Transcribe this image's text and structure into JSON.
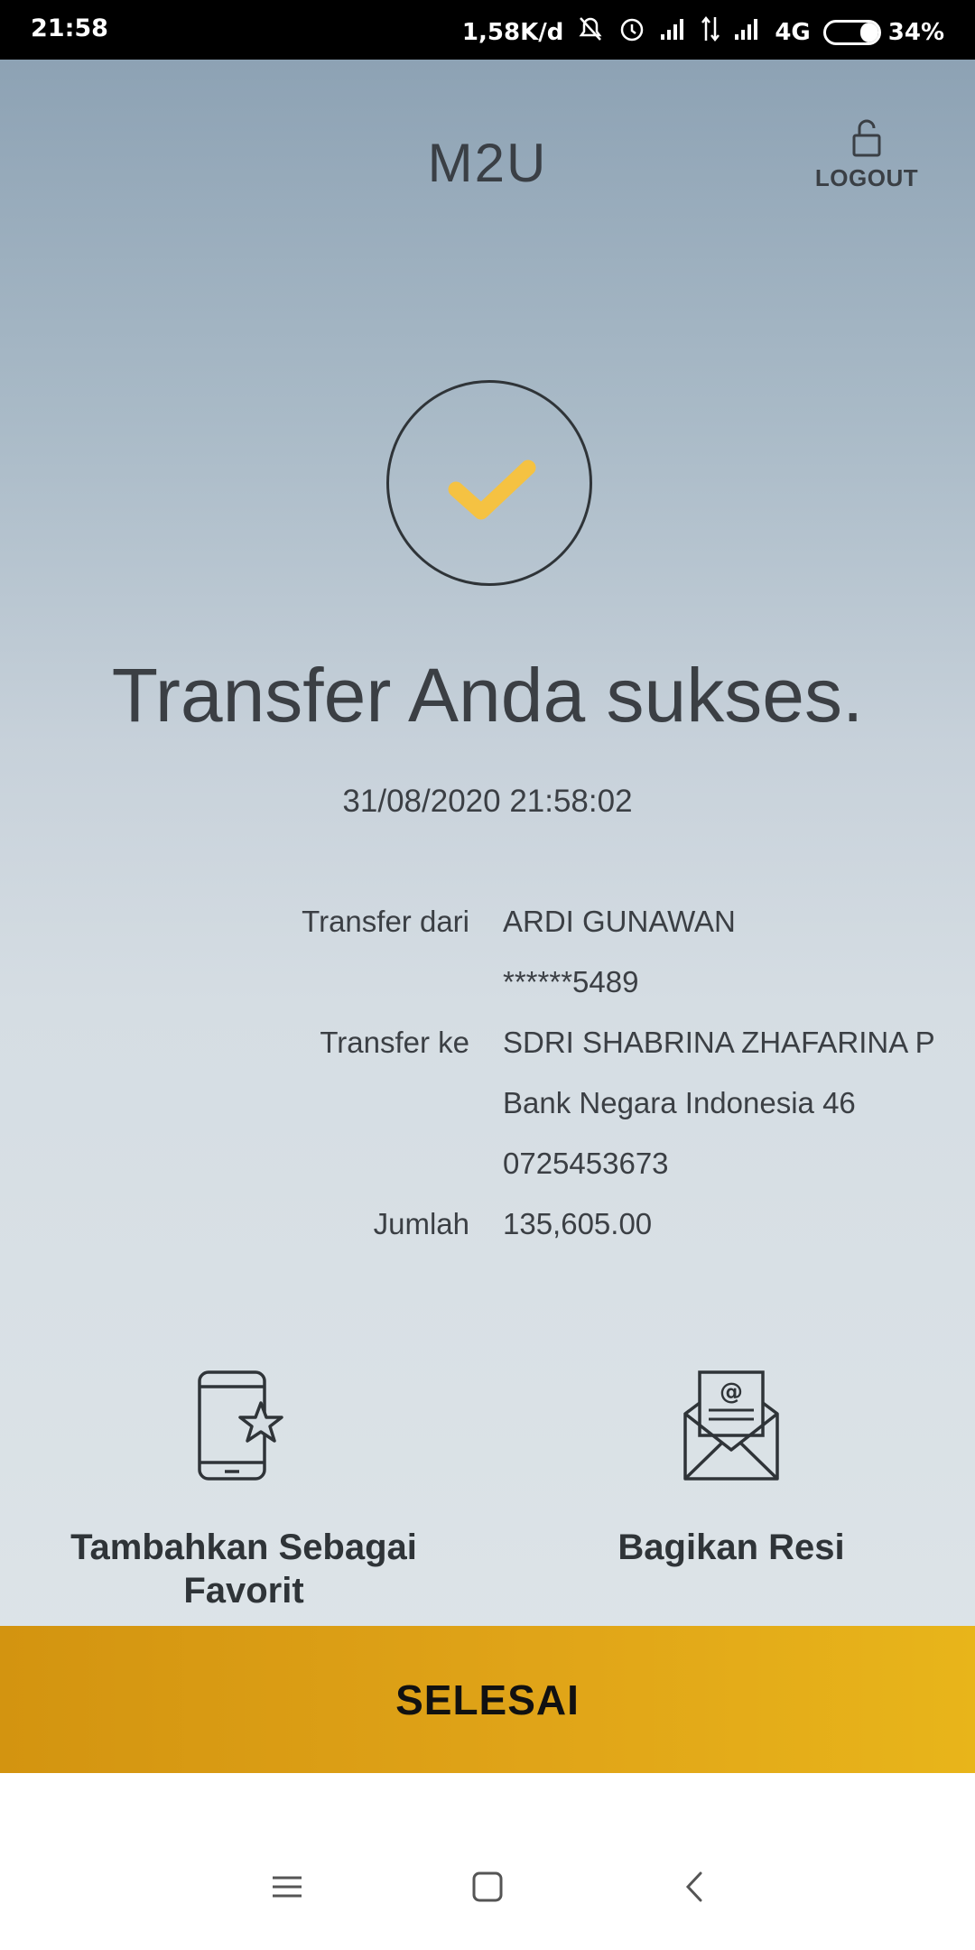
{
  "status_bar": {
    "time": "21:58",
    "speed": "1,58K/d",
    "network": "4G",
    "battery": "34%",
    "battery_level": 0.34,
    "icons": [
      "mute-icon",
      "alarm-icon",
      "signal-icon",
      "data-arrows-icon",
      "signal-icon"
    ]
  },
  "header": {
    "title": "M2U",
    "logout_label": "LOGOUT",
    "logout_icon": "unlock-icon"
  },
  "result": {
    "icon": "checkmark-icon",
    "icon_color": "#F5C242",
    "title": "Transfer Anda sukses.",
    "timestamp": "31/08/2020 21:58:02"
  },
  "details": {
    "from_label": "Transfer dari",
    "from_name": "ARDI GUNAWAN",
    "from_account": "******5489",
    "to_label": "Transfer ke",
    "to_name": "SDRI SHABRINA ZHAFARINA P",
    "to_bank": "Bank Negara Indonesia 46",
    "to_account": "0725453673",
    "amount_label": "Jumlah",
    "amount": "135,605.00"
  },
  "actions": {
    "favorite_label": "Tambahkan Sebagai Favorit",
    "share_label": "Bagikan Resi"
  },
  "done_button": {
    "label": "SELESAI",
    "color": "#DDA216"
  },
  "nav": {
    "icons": [
      "menu-icon",
      "home-square-icon",
      "back-chevron-icon"
    ]
  }
}
